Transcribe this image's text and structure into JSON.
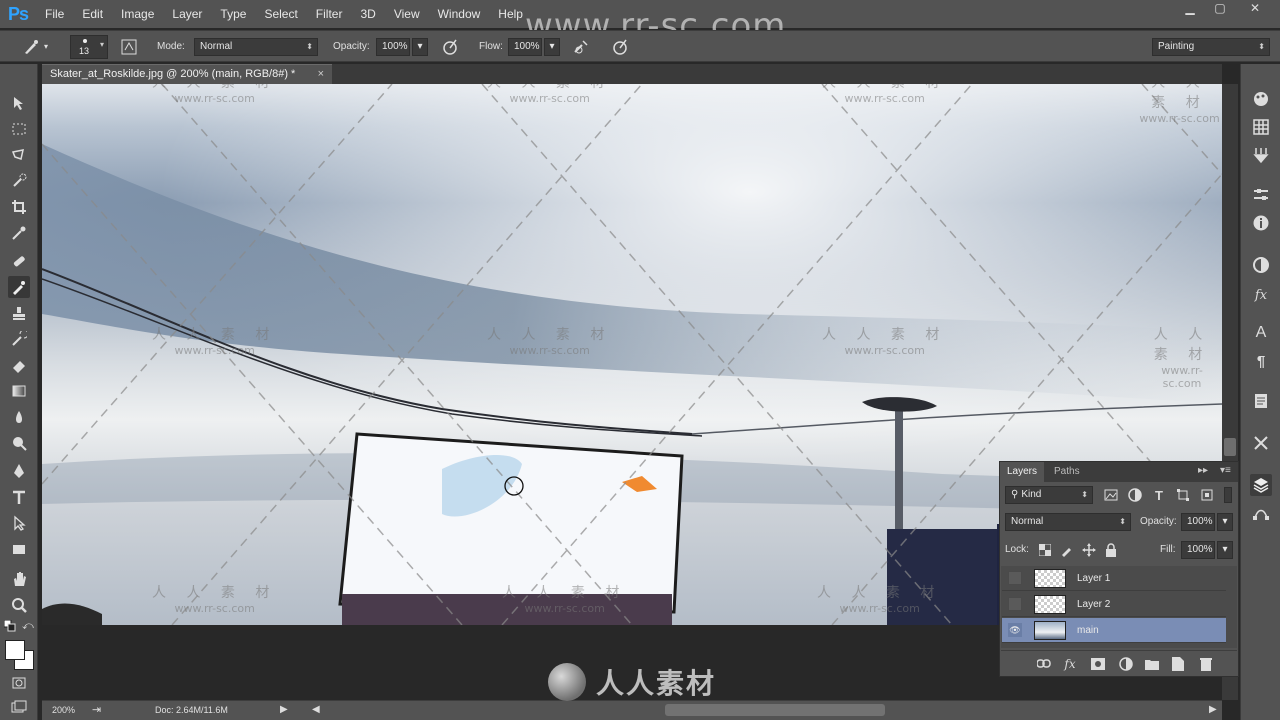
{
  "app": {
    "logo": "Ps",
    "menus": [
      "File",
      "Edit",
      "Image",
      "Layer",
      "Type",
      "Select",
      "Filter",
      "3D",
      "View",
      "Window",
      "Help"
    ],
    "watermark_url": "www.rr-sc.com",
    "watermark_cn": "人 人 素 材",
    "bottom_logo_text": "人人素材"
  },
  "options": {
    "brush_size": "13",
    "mode_label": "Mode:",
    "mode_value": "Normal",
    "opacity_label": "Opacity:",
    "opacity_value": "100%",
    "flow_label": "Flow:",
    "flow_value": "100%",
    "workspace": "Painting"
  },
  "document": {
    "tab_title": "Skater_at_Roskilde.jpg @ 200% (main, RGB/8#) *",
    "close": "×"
  },
  "statusbar": {
    "zoom": "200%",
    "doc_info": "Doc: 2.64M/11.6M"
  },
  "layers_panel": {
    "tabs": [
      "Layers",
      "Paths"
    ],
    "filter_kind": "Kind",
    "blend_mode": "Normal",
    "opacity_label": "Opacity:",
    "opacity_value": "100%",
    "lock_label": "Lock:",
    "fill_label": "Fill:",
    "fill_value": "100%",
    "layers": [
      {
        "name": "Layer 1",
        "visible": false,
        "selected": false
      },
      {
        "name": "Layer 2",
        "visible": false,
        "selected": false
      },
      {
        "name": "main",
        "visible": true,
        "selected": true
      }
    ]
  }
}
